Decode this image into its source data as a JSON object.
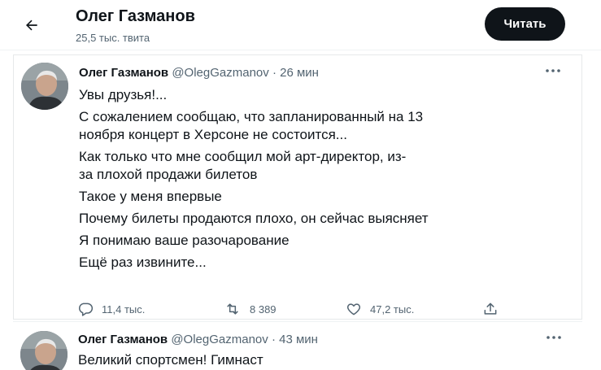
{
  "header": {
    "title": "Олег Газманов",
    "tweet_count": "25,5 тыс. твита",
    "follow_label": "Читать",
    "back_icon": "arrow-left-icon"
  },
  "tweets": [
    {
      "name": "Олег Газманов",
      "handle": "@OlegGazmanov",
      "separator": "·",
      "time": "26 мин",
      "lines": [
        "Увы друзья!...",
        "С сожалением сообщаю, что запланированный на 13",
        "ноября концерт в Херсоне не состоится...",
        "Как только что мне сообщил мой арт-директор, из-",
        "за плохой продажи билетов",
        "Такое у меня впервые",
        "Почему билеты продаются плохо, он сейчас выясняет",
        "Я понимаю ваше разочарование",
        "Ещё раз извините..."
      ],
      "replies": "11,4 тыс.",
      "retweets": "8 389",
      "likes": "47,2 тыс."
    },
    {
      "name": "Олег Газманов",
      "handle": "@OlegGazmanov",
      "separator": "·",
      "time": "43 мин",
      "lines": [
        "Великий спортсмен! Гимнаст"
      ]
    }
  ],
  "colors": {
    "text": "#0f1419",
    "secondary": "#536471",
    "button": "#0f1419",
    "border": "#eff3f4"
  }
}
